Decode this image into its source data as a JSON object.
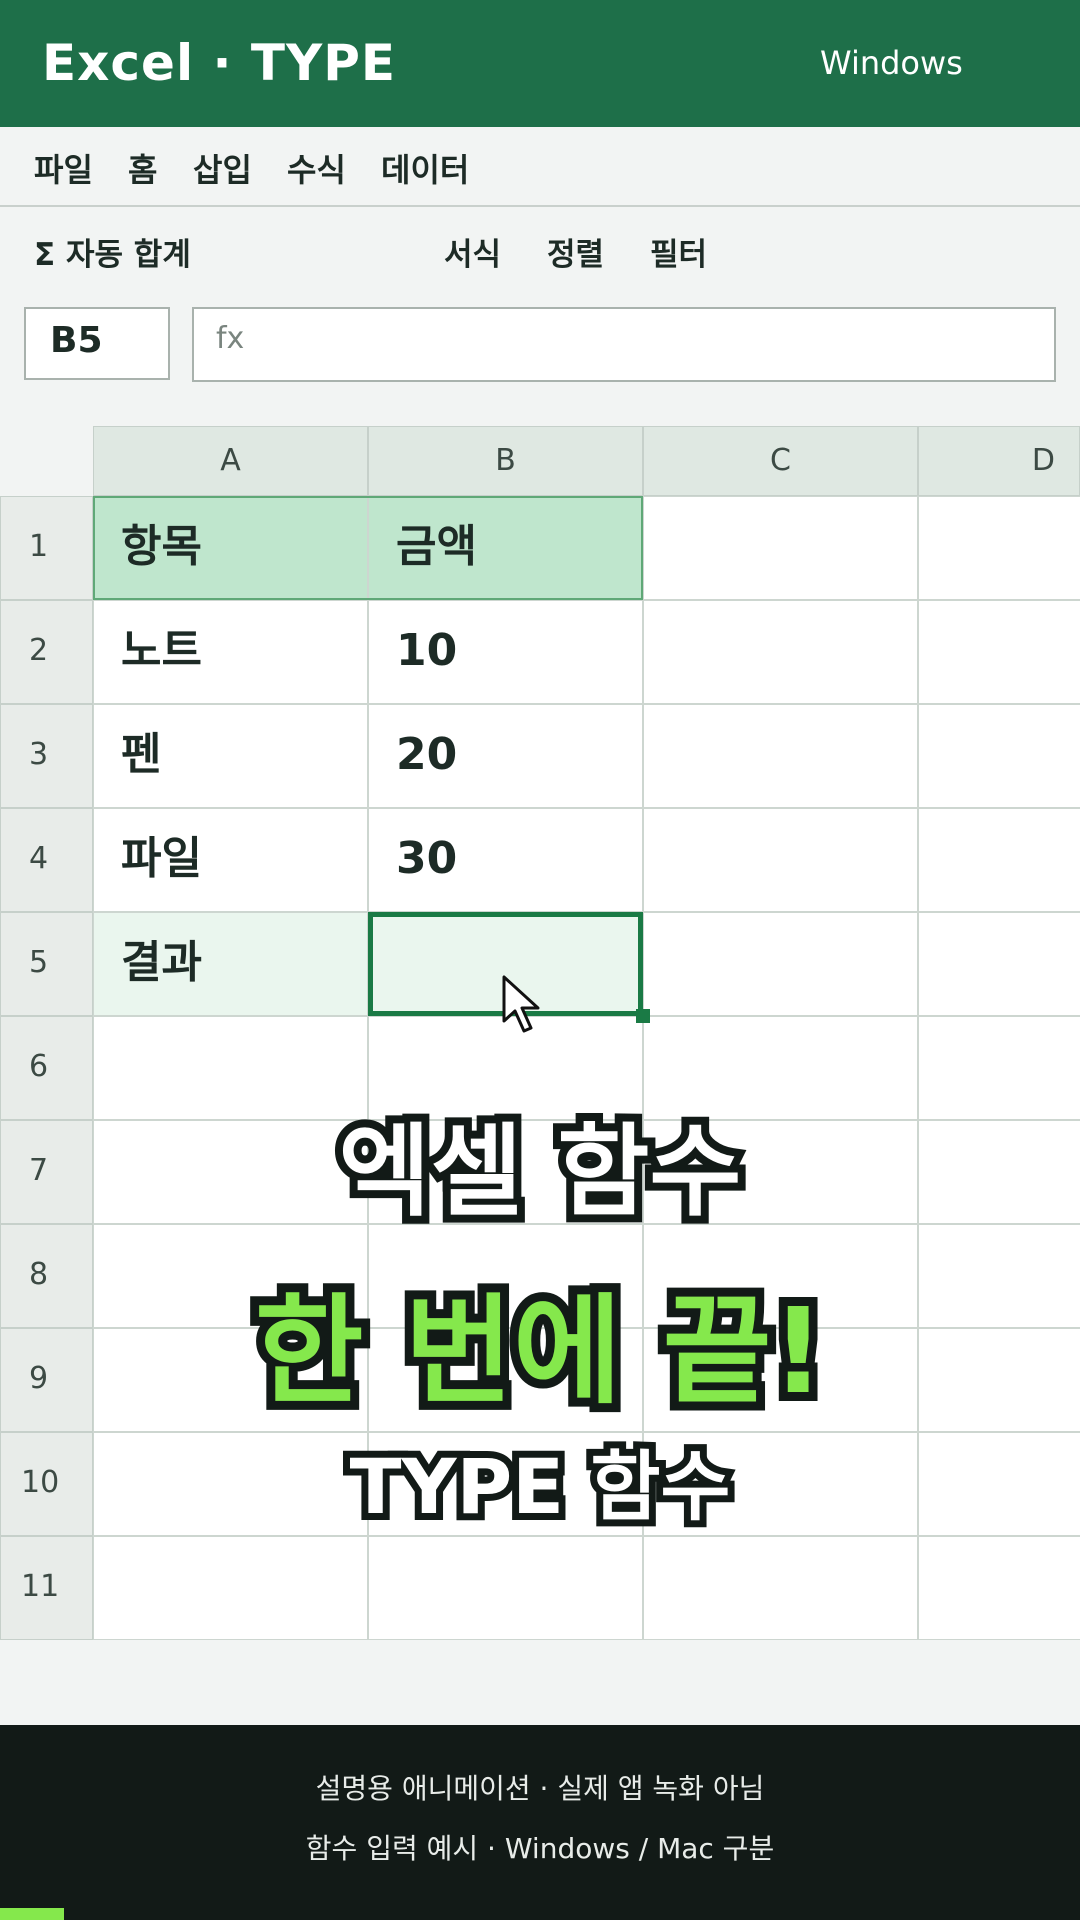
{
  "header": {
    "title": "Excel · TYPE",
    "platform": "Windows"
  },
  "menu": [
    "파일",
    "홈",
    "삽입",
    "수식",
    "데이터"
  ],
  "toolbar": {
    "autosum": "Σ 자동 합계",
    "format": "서식",
    "sort": "정렬",
    "filter": "필터"
  },
  "name_box": "B5",
  "formula_bar": {
    "placeholder": "fx",
    "value": ""
  },
  "columns": [
    "A",
    "B",
    "C",
    "D"
  ],
  "rows": [
    "1",
    "2",
    "3",
    "4",
    "5",
    "6",
    "7",
    "8",
    "9",
    "10",
    "11"
  ],
  "cells": {
    "A1": "항목",
    "B1": "금액",
    "A2": "노트",
    "B2": "10",
    "A3": "펜",
    "B3": "20",
    "A4": "파일",
    "B4": "30",
    "A5": "결과",
    "B5": ""
  },
  "overlay": {
    "line1": "엑셀 함수",
    "line2": "한 번에 끝!",
    "line3": "TYPE 함수"
  },
  "footer": {
    "line1": "설명용 애니메이션 · 실제 앱 녹화 아님",
    "line2": "함수 입력 예시 · Windows / Mac 구분"
  },
  "colors": {
    "brand": "#1e6f49",
    "accent": "#85e84c",
    "header_fill": "#bfe6cd",
    "selection": "#1a7a45"
  }
}
